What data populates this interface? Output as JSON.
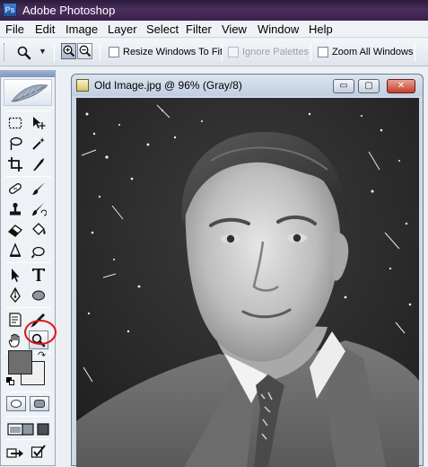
{
  "window": {
    "title": "Adobe Photoshop",
    "app_icon_text": "Ps"
  },
  "menu": {
    "items": [
      "File",
      "Edit",
      "Image",
      "Layer",
      "Select",
      "Filter",
      "View",
      "Window",
      "Help"
    ]
  },
  "options_bar": {
    "current_tool_icon": "magnifier-icon",
    "zoom_in_icon": "zoom-in-icon",
    "zoom_out_icon": "zoom-out-icon",
    "resize_windows_to_fit": {
      "label": "Resize Windows To Fit",
      "checked": false,
      "enabled": true
    },
    "ignore_palettes": {
      "label": "Ignore Palettes",
      "checked": false,
      "enabled": false
    },
    "zoom_all_windows": {
      "label": "Zoom All Windows",
      "checked": false,
      "enabled": true
    }
  },
  "toolbox": {
    "highlighted_tool": "zoom-tool",
    "highlight_color": "#e01010",
    "foreground_color": "#6e6e6e",
    "background_color": "#f0f0f0"
  },
  "document": {
    "title": "Old Image.jpg @ 96% (Gray/8)",
    "minimize_label": "▭",
    "maximize_label": "▢",
    "close_label": "✕"
  }
}
